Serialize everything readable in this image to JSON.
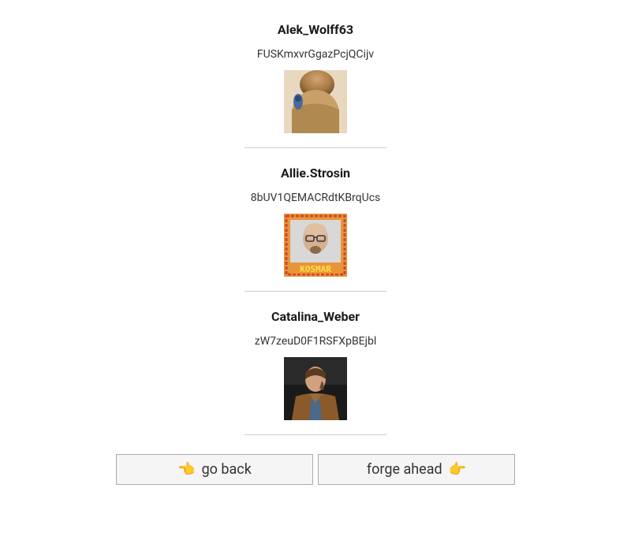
{
  "users": [
    {
      "username": "Alek_Wolff63",
      "code": "FUSKmxvrGgazPcjQCijv",
      "avatar_icon": "avatar-hair-bun"
    },
    {
      "username": "Allie.Strosin",
      "code": "8bUV1QEMACRdtKBrqUcs",
      "avatar_icon": "avatar-bald-glasses",
      "avatar_caption": "KOSMAR"
    },
    {
      "username": "Catalina_Weber",
      "code": "zW7zeuD0F1RSFXpBEjbl",
      "avatar_icon": "avatar-man-jacket"
    }
  ],
  "buttons": {
    "back_label": "go back",
    "forward_label": "forge ahead"
  }
}
